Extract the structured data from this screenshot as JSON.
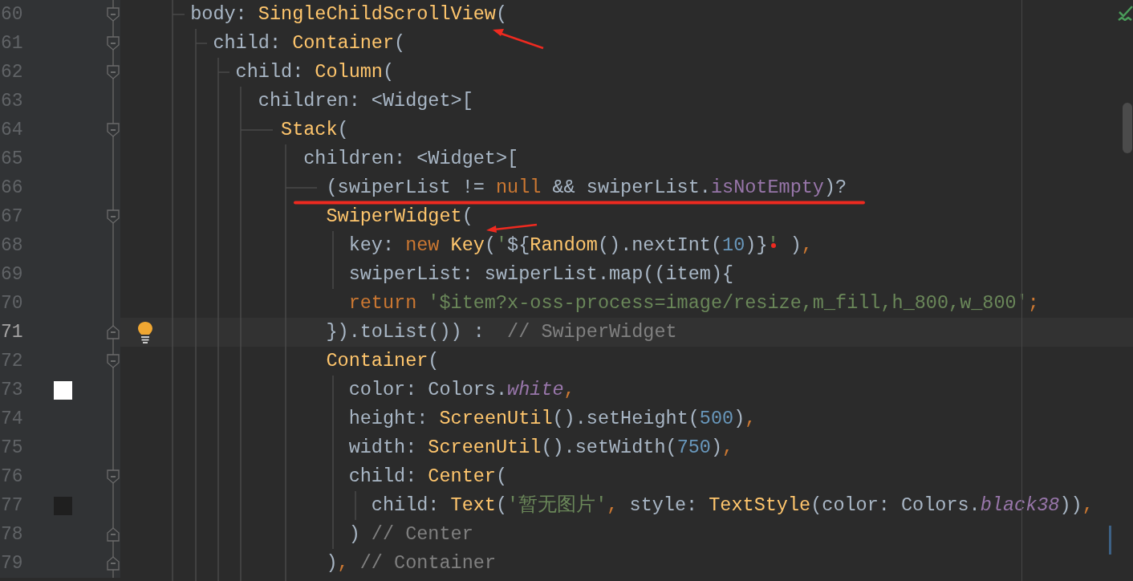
{
  "editor": {
    "lines": [
      {
        "number": "60",
        "fold_start": true,
        "fold_end": false,
        "current": false,
        "tokens": [
          {
            "kind": "plain",
            "text": "  body: "
          },
          {
            "kind": "type",
            "text": "SingleChildScrollView"
          },
          {
            "kind": "plain",
            "text": "("
          }
        ]
      },
      {
        "number": "61",
        "fold_start": true,
        "fold_end": false,
        "current": false,
        "tokens": [
          {
            "kind": "plain",
            "text": "    child: "
          },
          {
            "kind": "type",
            "text": "Container"
          },
          {
            "kind": "plain",
            "text": "("
          }
        ]
      },
      {
        "number": "62",
        "fold_start": true,
        "fold_end": false,
        "current": false,
        "tokens": [
          {
            "kind": "plain",
            "text": "      child: "
          },
          {
            "kind": "type",
            "text": "Column"
          },
          {
            "kind": "plain",
            "text": "("
          }
        ]
      },
      {
        "number": "63",
        "fold_start": false,
        "fold_end": false,
        "current": false,
        "tokens": [
          {
            "kind": "plain",
            "text": "        children: <Widget>["
          }
        ]
      },
      {
        "number": "64",
        "fold_start": true,
        "fold_end": false,
        "current": false,
        "tokens": [
          {
            "kind": "type",
            "text": "          Stack"
          },
          {
            "kind": "plain",
            "text": "("
          }
        ]
      },
      {
        "number": "65",
        "fold_start": false,
        "fold_end": false,
        "current": false,
        "tokens": [
          {
            "kind": "plain",
            "text": "            children: <Widget>["
          }
        ]
      },
      {
        "number": "66",
        "fold_start": false,
        "fold_end": false,
        "current": false,
        "tokens": [
          {
            "kind": "plain",
            "text": "              (swiperList != "
          },
          {
            "kind": "keyword",
            "text": "null"
          },
          {
            "kind": "plain",
            "text": " && swiperList."
          },
          {
            "kind": "member",
            "text": "isNotEmpty"
          },
          {
            "kind": "plain",
            "text": ")?"
          }
        ]
      },
      {
        "number": "67",
        "fold_start": true,
        "fold_end": false,
        "current": false,
        "tokens": [
          {
            "kind": "type",
            "text": "              SwiperWidget"
          },
          {
            "kind": "plain",
            "text": "("
          }
        ]
      },
      {
        "number": "68",
        "fold_start": false,
        "fold_end": false,
        "current": false,
        "tokens": [
          {
            "kind": "plain",
            "text": "                key: "
          },
          {
            "kind": "keyword",
            "text": "new "
          },
          {
            "kind": "type",
            "text": "Key"
          },
          {
            "kind": "plain",
            "text": "("
          },
          {
            "kind": "string",
            "text": "'"
          },
          {
            "kind": "plain",
            "text": "${"
          },
          {
            "kind": "type",
            "text": "Random"
          },
          {
            "kind": "plain",
            "text": "().nextInt("
          },
          {
            "kind": "number",
            "text": "10"
          },
          {
            "kind": "plain",
            "text": ")}"
          },
          {
            "kind": "string",
            "text": "'"
          },
          {
            "kind": "plain",
            "text": " )"
          },
          {
            "kind": "keyword",
            "text": ","
          }
        ]
      },
      {
        "number": "69",
        "fold_start": false,
        "fold_end": false,
        "current": false,
        "tokens": [
          {
            "kind": "plain",
            "text": "                swiperList: swiperList.map((item){"
          }
        ]
      },
      {
        "number": "70",
        "fold_start": false,
        "fold_end": false,
        "current": false,
        "tokens": [
          {
            "kind": "keyword",
            "text": "                return "
          },
          {
            "kind": "string",
            "text": "'$item?x-oss-process=image/resize,m_fill,h_800,w_800'"
          },
          {
            "kind": "keyword",
            "text": ";"
          }
        ]
      },
      {
        "number": "71",
        "fold_start": false,
        "fold_end": true,
        "current": true,
        "tokens": [
          {
            "kind": "plain",
            "text": "              }).toList()) :  "
          },
          {
            "kind": "comment",
            "text": "// SwiperWidget"
          }
        ]
      },
      {
        "number": "72",
        "fold_start": true,
        "fold_end": false,
        "current": false,
        "tokens": [
          {
            "kind": "type",
            "text": "              Container"
          },
          {
            "kind": "plain",
            "text": "("
          }
        ]
      },
      {
        "number": "73",
        "fold_start": false,
        "fold_end": false,
        "current": false,
        "color": "#ffffff",
        "tokens": [
          {
            "kind": "plain",
            "text": "                color: Colors."
          },
          {
            "kind": "constant",
            "text": "white"
          },
          {
            "kind": "keyword",
            "text": ","
          }
        ]
      },
      {
        "number": "74",
        "fold_start": false,
        "fold_end": false,
        "current": false,
        "tokens": [
          {
            "kind": "plain",
            "text": "                height: "
          },
          {
            "kind": "type",
            "text": "ScreenUtil"
          },
          {
            "kind": "plain",
            "text": "().setHeight("
          },
          {
            "kind": "number",
            "text": "500"
          },
          {
            "kind": "plain",
            "text": ")"
          },
          {
            "kind": "keyword",
            "text": ","
          }
        ]
      },
      {
        "number": "75",
        "fold_start": false,
        "fold_end": false,
        "current": false,
        "tokens": [
          {
            "kind": "plain",
            "text": "                width: "
          },
          {
            "kind": "type",
            "text": "ScreenUtil"
          },
          {
            "kind": "plain",
            "text": "().setWidth("
          },
          {
            "kind": "number",
            "text": "750"
          },
          {
            "kind": "plain",
            "text": ")"
          },
          {
            "kind": "keyword",
            "text": ","
          }
        ]
      },
      {
        "number": "76",
        "fold_start": true,
        "fold_end": false,
        "current": false,
        "tokens": [
          {
            "kind": "plain",
            "text": "                child: "
          },
          {
            "kind": "type",
            "text": "Center"
          },
          {
            "kind": "plain",
            "text": "("
          }
        ]
      },
      {
        "number": "77",
        "fold_start": false,
        "fold_end": false,
        "current": false,
        "color": "#1f1f1f",
        "tokens": [
          {
            "kind": "plain",
            "text": "                  child: "
          },
          {
            "kind": "type",
            "text": "Text"
          },
          {
            "kind": "plain",
            "text": "("
          },
          {
            "kind": "string",
            "text": "'暂无图片'"
          },
          {
            "kind": "keyword",
            "text": ","
          },
          {
            "kind": "plain",
            "text": " style: "
          },
          {
            "kind": "type",
            "text": "TextStyle"
          },
          {
            "kind": "plain",
            "text": "(color: Colors."
          },
          {
            "kind": "constant",
            "text": "black38"
          },
          {
            "kind": "plain",
            "text": "))"
          },
          {
            "kind": "keyword",
            "text": ","
          }
        ]
      },
      {
        "number": "78",
        "fold_start": false,
        "fold_end": true,
        "current": false,
        "tokens": [
          {
            "kind": "plain",
            "text": "                ) "
          },
          {
            "kind": "comment",
            "text": "// Center"
          }
        ]
      },
      {
        "number": "79",
        "fold_start": false,
        "fold_end": true,
        "current": false,
        "tokens": [
          {
            "kind": "plain",
            "text": "              )"
          },
          {
            "kind": "keyword",
            "text": ", "
          },
          {
            "kind": "comment",
            "text": "// Container"
          }
        ]
      }
    ]
  }
}
